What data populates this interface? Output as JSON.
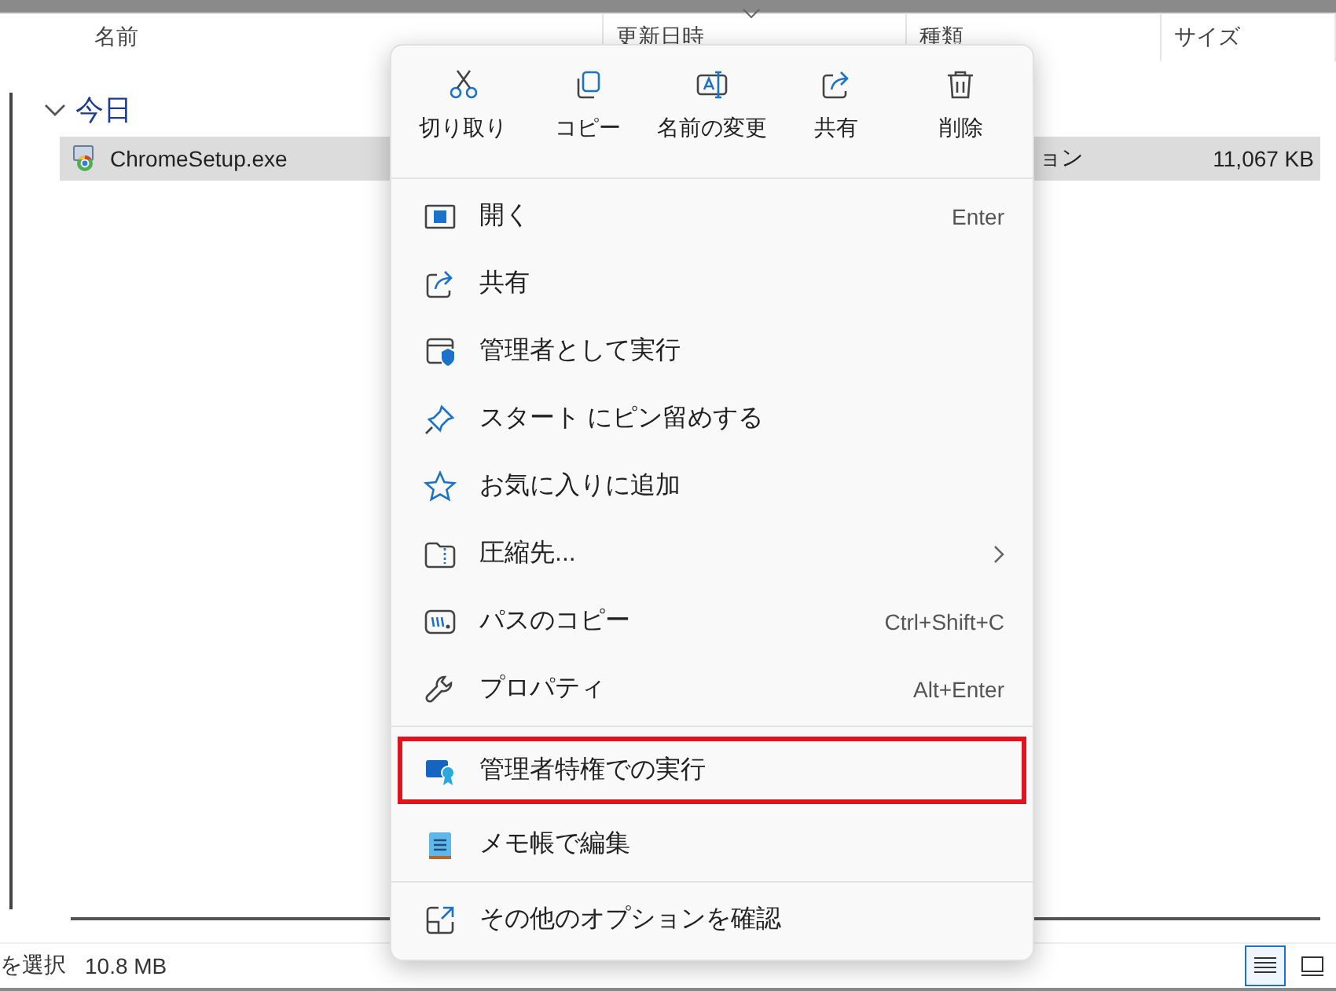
{
  "columns": [
    {
      "label": "名前"
    },
    {
      "label": "更新日時",
      "sorted": true
    },
    {
      "label": "種類"
    },
    {
      "label": "サイズ"
    }
  ],
  "group": {
    "label": "今日",
    "expanded": true
  },
  "files": [
    {
      "name": "ChromeSetup.exe",
      "type": "ョン",
      "size": "11,067 KB",
      "selected": true
    }
  ],
  "status": {
    "selection": "を選択",
    "size": "10.8 MB"
  },
  "views": [
    {
      "kind": "details",
      "selected": true
    },
    {
      "kind": "tiles",
      "selected": false
    }
  ],
  "context_menu": {
    "toolbar": [
      {
        "kind": "cut",
        "label": "切り取り"
      },
      {
        "kind": "copy",
        "label": "コピー"
      },
      {
        "kind": "rename",
        "label": "名前の変更"
      },
      {
        "kind": "share",
        "label": "共有"
      },
      {
        "kind": "delete",
        "label": "削除"
      }
    ],
    "sections": [
      [
        {
          "kind": "open",
          "label": "開く",
          "shortcut": "Enter"
        },
        {
          "kind": "share",
          "label": "共有"
        },
        {
          "kind": "admin",
          "label": "管理者として実行"
        },
        {
          "kind": "pin",
          "label": "スタート にピン留めする"
        },
        {
          "kind": "star",
          "label": "お気に入りに追加"
        },
        {
          "kind": "zip",
          "label": "圧縮先...",
          "has_submenu": true
        },
        {
          "kind": "path",
          "label": "パスのコピー",
          "shortcut": "Ctrl+Shift+C"
        },
        {
          "kind": "wrench",
          "label": "プロパティ",
          "shortcut": "Alt+Enter"
        }
      ],
      [
        {
          "kind": "privilege",
          "label": "管理者特権での実行",
          "highlighted": true
        },
        {
          "kind": "notepad",
          "label": "メモ帳で編集"
        }
      ],
      [
        {
          "kind": "more",
          "label": "その他のオプションを確認"
        }
      ]
    ]
  }
}
